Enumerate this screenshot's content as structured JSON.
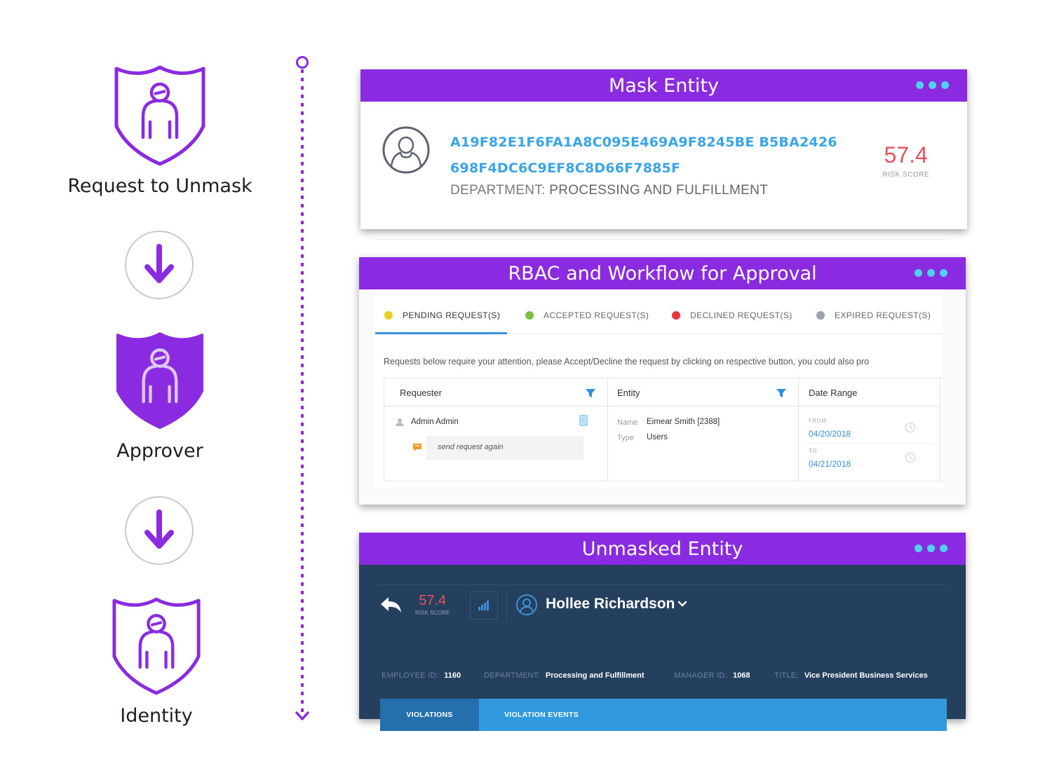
{
  "flow": {
    "steps": [
      {
        "label": "Request to Unmask",
        "icon": "outline-shield-person-icon"
      },
      {
        "label": "Approver",
        "icon": "filled-shield-person-icon"
      },
      {
        "label": "Identity",
        "icon": "outline-shield-person-icon"
      }
    ],
    "arrow_icon": "down-arrow-icon",
    "accent_color": "#8a2be2"
  },
  "mask_panel": {
    "title": "Mask Entity",
    "entity_id_line1": "A19F82E1F6FA1A8C095E469A9F8245BE B5BA2426",
    "entity_id_line2": "698F4DC6C9EF8C8D66F7885F",
    "department_key": "DEPARTMENT:",
    "department_value": "PROCESSING AND FULFILLMENT",
    "risk_score": "57.4",
    "risk_label": "RISK SCORE"
  },
  "approval_panel": {
    "title": "RBAC and Workflow for Approval",
    "tabs": [
      {
        "label": "PENDING REQUEST(S)",
        "color": "#e6d21a"
      },
      {
        "label": "ACCEPTED REQUEST(S)",
        "color": "#7cc046"
      },
      {
        "label": "DECLINED REQUEST(S)",
        "color": "#e8343c"
      },
      {
        "label": "EXPIRED REQUEST(S)",
        "color": "#9aa3ab"
      }
    ],
    "notice": "Requests below require your attention, please Accept/Decline the request by clicking on respective button, you could also pro",
    "columns": [
      "Requester",
      "Entity",
      "Date Range"
    ],
    "row": {
      "requester": "Admin Admin",
      "resend": "send request again",
      "name_key": "Name",
      "name_value": "Eimear Smith [2388]",
      "type_key": "Type",
      "type_value": "Users",
      "from_key": "FROM",
      "from_value": "04/20/2018",
      "to_key": "TO",
      "to_value": "04/21/2018"
    }
  },
  "unmask_panel": {
    "title": "Unmasked Entity",
    "risk_score": "57.4",
    "risk_label": "RISK SCORE",
    "name": "Hollee Richardson",
    "meta": [
      {
        "key": "EMPLOYEE ID:",
        "value": "1160"
      },
      {
        "key": "DEPARTMENT:",
        "value": "Processing and Fulfillment"
      },
      {
        "key": "MANAGER ID:",
        "value": "1068"
      },
      {
        "key": "TITLE:",
        "value": "Vice President Business Services"
      }
    ],
    "tabs": [
      "VIOLATIONS",
      "VIOLATION EVENTS"
    ]
  }
}
